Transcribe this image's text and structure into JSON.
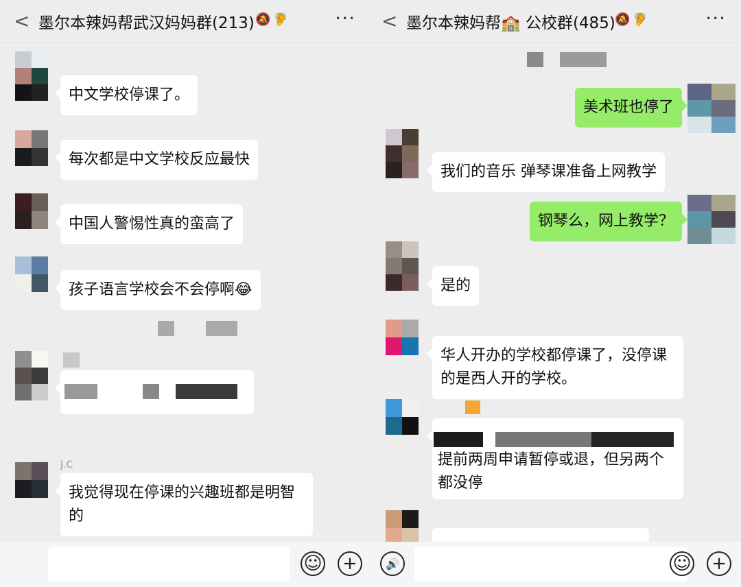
{
  "left_chat": {
    "title": "墨尔本辣妈帮武汉妈妈群(213)",
    "messages": [
      {
        "text": "中文学校停课了。"
      },
      {
        "text": "每次都是中文学校反应最快"
      },
      {
        "text": "中国人警惕性真的蛮高了"
      },
      {
        "text": "孩子语言学校会不会停啊😂"
      },
      {
        "sender": "J.C",
        "text": "我觉得现在停课的兴趣班都是明智的"
      }
    ]
  },
  "right_chat": {
    "title": "墨尔本辣妈帮🏫 公校群(485)",
    "messages": [
      {
        "text": "美术班也停了",
        "outgoing": true
      },
      {
        "text": "我们的音乐 弹琴课准备上网教学"
      },
      {
        "text": "钢琴么，网上教学？",
        "outgoing": true
      },
      {
        "text": "是的"
      },
      {
        "text": "华人开办的学校都停课了，没停课的是西人开的学校。"
      },
      {
        "text": "提前两周申请暂停或退，但另两个都没停"
      }
    ]
  },
  "glyphs": {
    "back": "<",
    "more": "···",
    "mute": "🔕",
    "ear": "🦻",
    "emoji": "☺",
    "plus": "+",
    "voice": "🔊"
  },
  "colors": {
    "background": "#ededed",
    "bubble_in": "#ffffff",
    "bubble_out": "#95ec69"
  }
}
